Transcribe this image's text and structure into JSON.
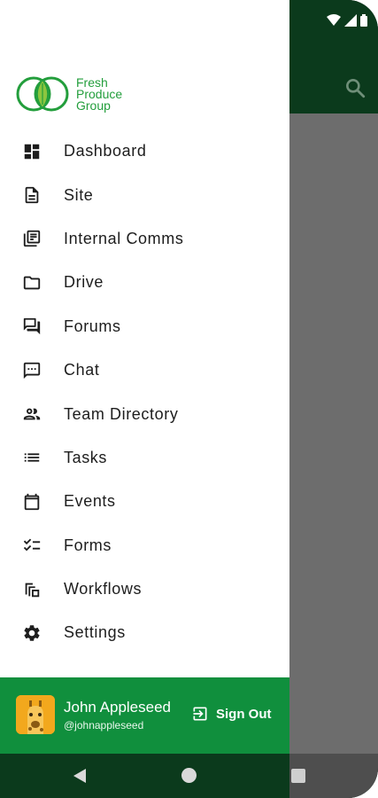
{
  "brand": {
    "line1": "Fresh",
    "line2": "Produce",
    "line3": "Group",
    "color": "#239e3c"
  },
  "theme": {
    "dark_green": "#0b3a1c",
    "footer_green": "#108f3d",
    "scrim": "#6d6d6d"
  },
  "menu": [
    {
      "label": "Dashboard",
      "icon": "dashboard-icon"
    },
    {
      "label": "Site",
      "icon": "document-icon"
    },
    {
      "label": "Internal Comms",
      "icon": "copy-icon"
    },
    {
      "label": "Drive",
      "icon": "folder-icon"
    },
    {
      "label": "Forums",
      "icon": "forum-icon"
    },
    {
      "label": "Chat",
      "icon": "chat-icon"
    },
    {
      "label": "Team Directory",
      "icon": "people-icon"
    },
    {
      "label": "Tasks",
      "icon": "list-icon"
    },
    {
      "label": "Events",
      "icon": "calendar-icon"
    },
    {
      "label": "Forms",
      "icon": "checklist-icon"
    },
    {
      "label": "Workflows",
      "icon": "workflow-icon"
    },
    {
      "label": "Settings",
      "icon": "gear-icon"
    }
  ],
  "account": {
    "name": "John Appleseed",
    "handle": "@johnappleseed",
    "sign_out": "Sign Out"
  }
}
